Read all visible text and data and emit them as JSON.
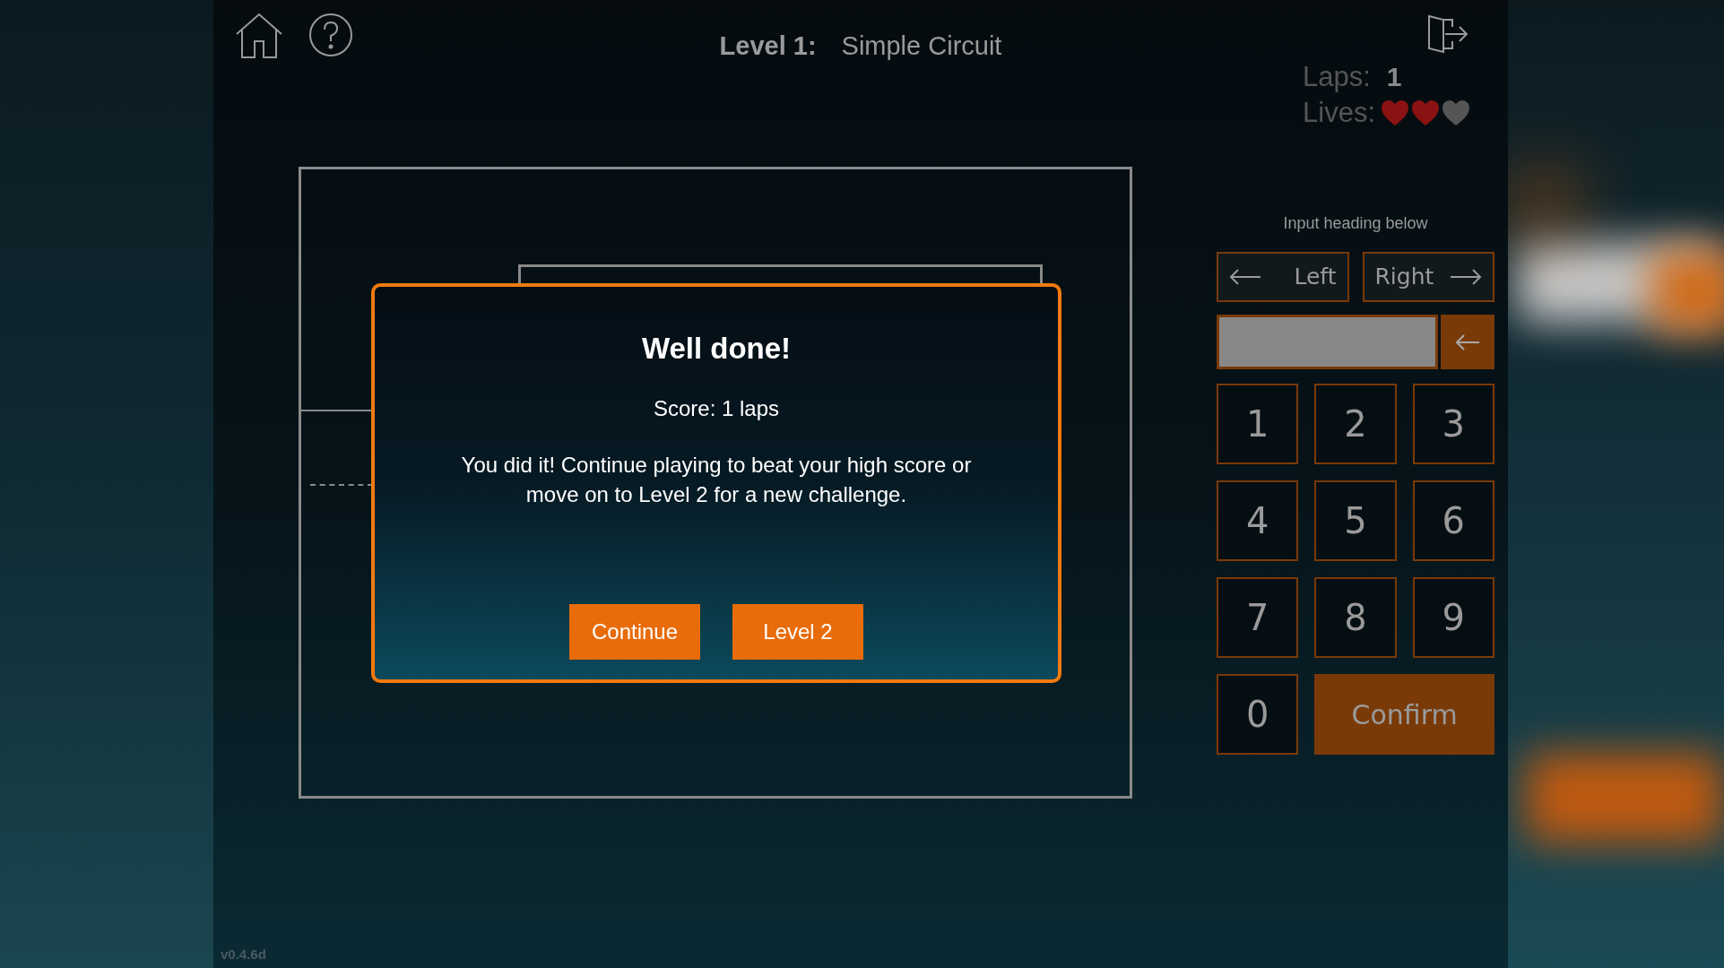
{
  "header": {
    "title_label": "Level 1:",
    "title": "Simple Circuit"
  },
  "stats": {
    "laps_label": "Laps:",
    "laps": "1",
    "lives_label": "Lives:",
    "lives": [
      {
        "filled": true
      },
      {
        "filled": true
      },
      {
        "filled": false
      }
    ]
  },
  "dialog": {
    "title": "Well done!",
    "score": "Score: 1 laps",
    "message": "You did it! Continue playing to beat your high score or move on to Level 2 for a new challenge.",
    "buttons": [
      "Continue",
      "Level 2"
    ]
  },
  "heading_input": {
    "prompt": "Input heading below",
    "turn_buttons": [
      "Left",
      "Right"
    ],
    "keys": [
      "1",
      "2",
      "3",
      "4",
      "5",
      "6",
      "7",
      "8",
      "9",
      "0"
    ],
    "confirm": "Confirm"
  },
  "version": "v0.4.6d"
}
